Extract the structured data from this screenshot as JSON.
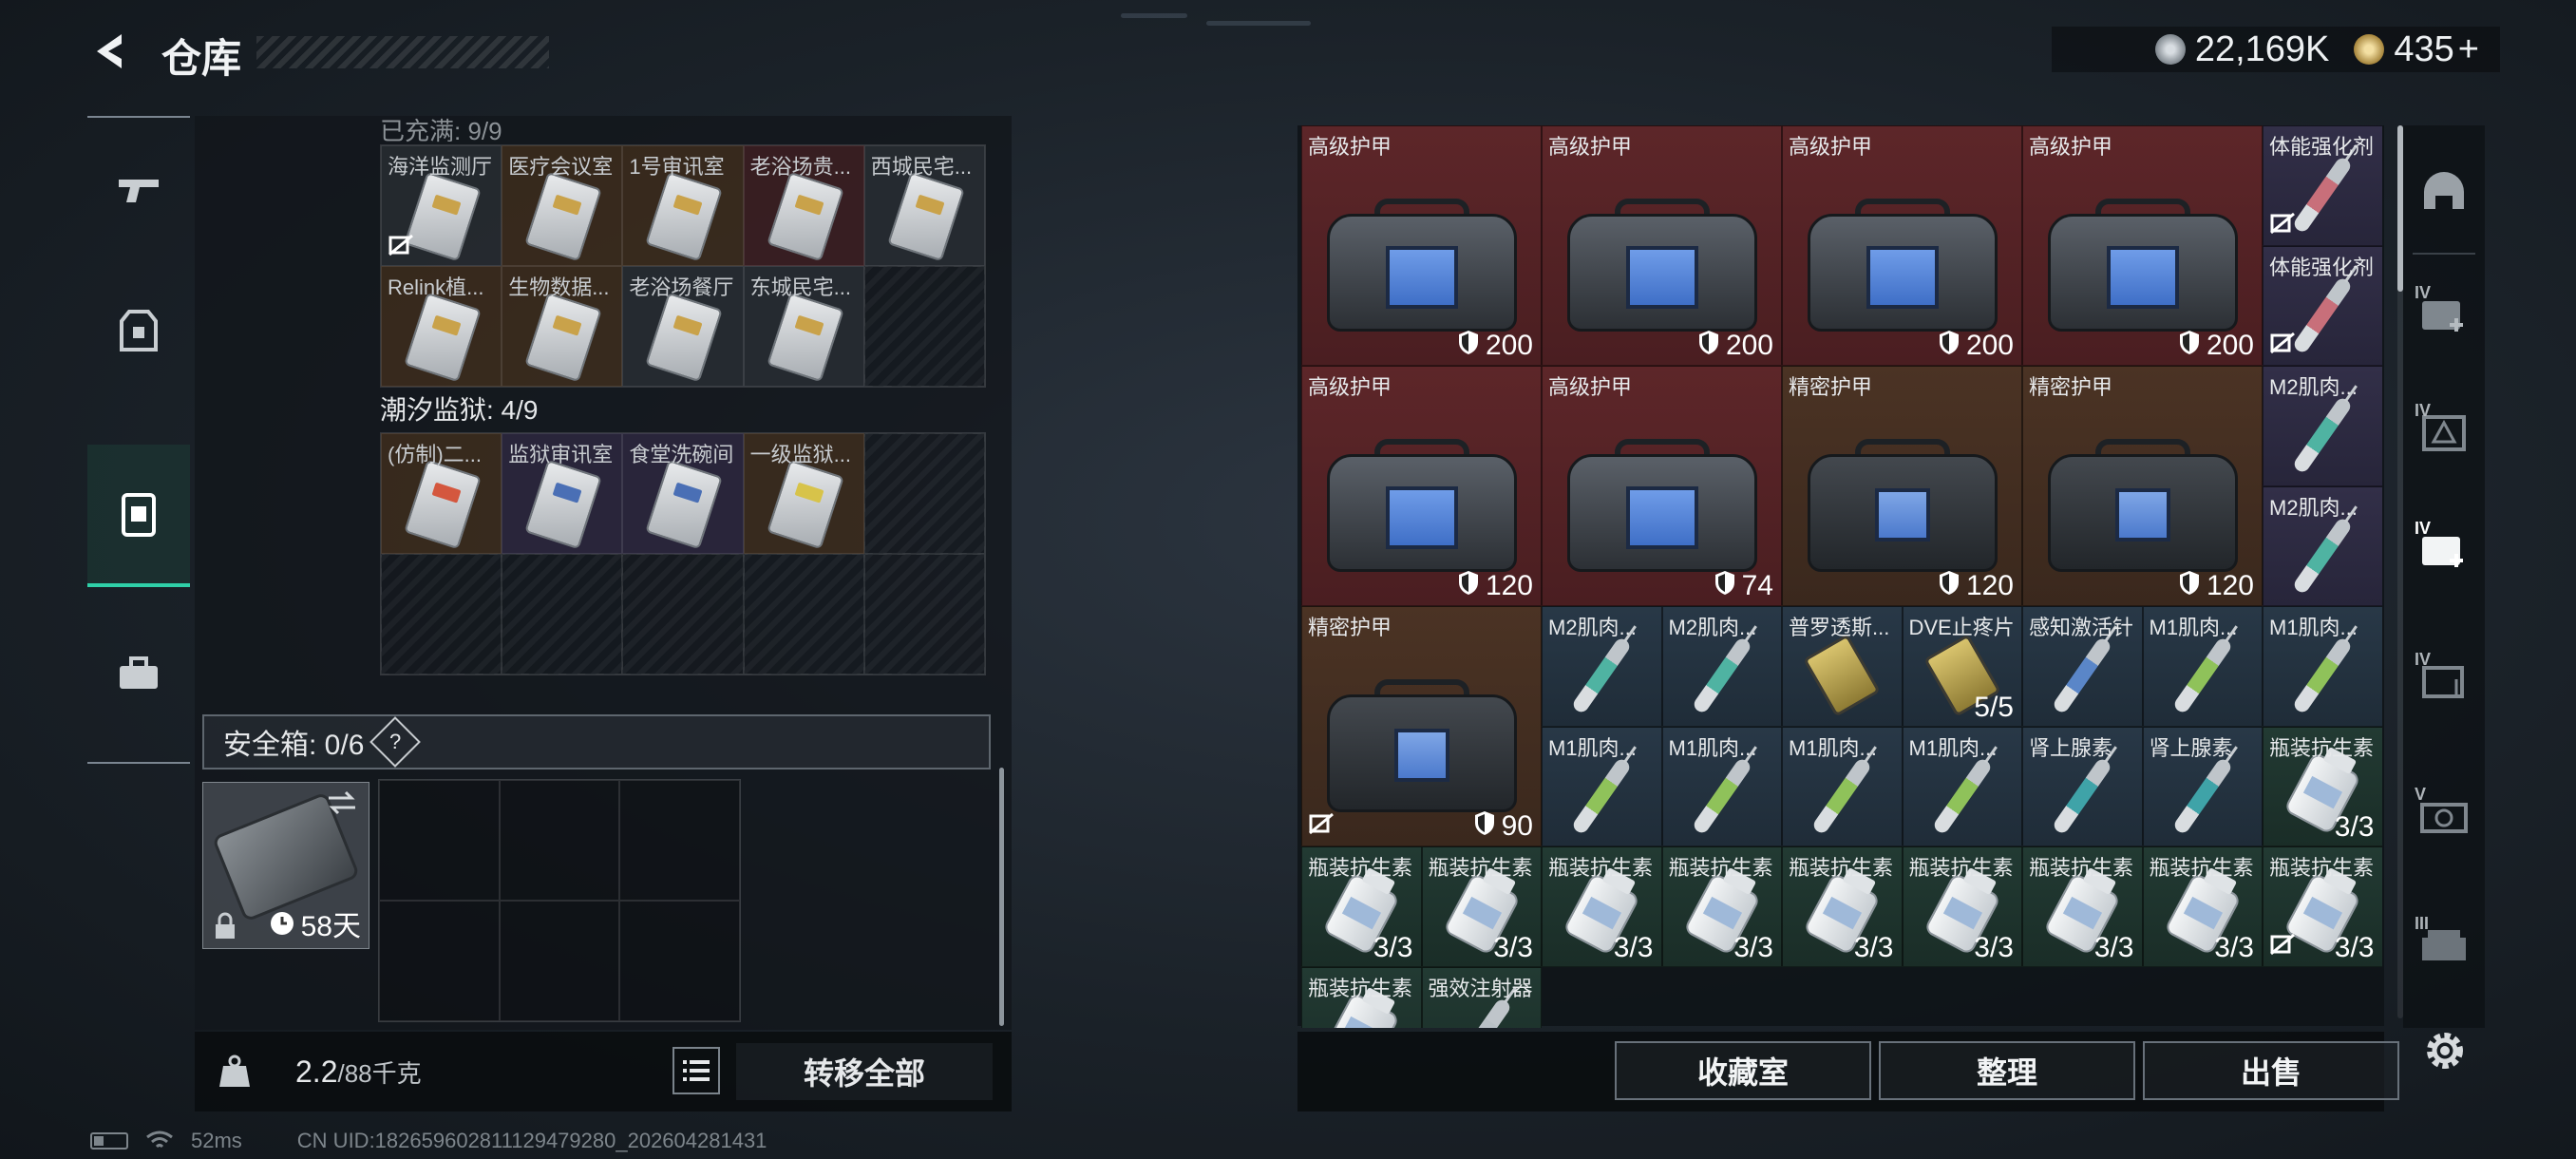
{
  "header": {
    "title": "仓库",
    "silver": "22,169K",
    "gold": "435",
    "gold_plus": "+"
  },
  "left": {
    "faded_title": "已充满: 9/9",
    "top_keys": [
      {
        "label": "海洋监测厅",
        "tint": "gray",
        "card": "",
        "noicon": true
      },
      {
        "label": "医疗会议室",
        "tint": "orange",
        "card": "",
        "noicon": false
      },
      {
        "label": "1号审讯室",
        "tint": "orange",
        "card": "",
        "noicon": false
      },
      {
        "label": "老浴场贵...",
        "tint": "red",
        "card": "",
        "noicon": false
      },
      {
        "label": "西城民宅...",
        "tint": "gray",
        "card": "",
        "noicon": false
      },
      {
        "label": "Relink植...",
        "tint": "orange",
        "card": "",
        "noicon": false
      },
      {
        "label": "生物数据...",
        "tint": "orange",
        "card": "",
        "noicon": false
      },
      {
        "label": "老浴场餐厅",
        "tint": "gray",
        "card": "",
        "noicon": false
      },
      {
        "label": "东城民宅...",
        "tint": "gray",
        "card": "",
        "noicon": false
      },
      {
        "label": "",
        "tint": "empty",
        "card": "",
        "noicon": false
      }
    ],
    "prison_title": "潮汐监狱: 4/9",
    "prison_keys": [
      {
        "label": "(仿制)二...",
        "tint": "orange",
        "card": "red"
      },
      {
        "label": "监狱审讯室",
        "tint": "purple",
        "card": "blue"
      },
      {
        "label": "食堂洗碗间",
        "tint": "purple",
        "card": "blue"
      },
      {
        "label": "一级监狱...",
        "tint": "orange",
        "card": "yellow"
      }
    ],
    "safebox_label": "安全箱: 0/6",
    "safebox_help": "?",
    "safe_days": "58天",
    "weight": "2.2",
    "weight_max": "/88千克",
    "transfer_all": "转移全部"
  },
  "status": {
    "ping": "52ms",
    "uid": "CN UID:1826596028111294792​80_202604281431"
  },
  "inventory": {
    "large": [
      {
        "name": "高级护甲",
        "val": "200",
        "quality": "red",
        "kind": "bag",
        "noicon": false
      },
      {
        "name": "高级护甲",
        "val": "200",
        "quality": "red",
        "kind": "bag",
        "noicon": false
      },
      {
        "name": "高级护甲",
        "val": "200",
        "quality": "red",
        "kind": "bag",
        "noicon": false
      },
      {
        "name": "高级护甲",
        "val": "200",
        "quality": "red",
        "kind": "bag",
        "noicon": false
      },
      {
        "name": "高级护甲",
        "val": "120",
        "quality": "red",
        "kind": "bag",
        "noicon": false
      },
      {
        "name": "高级护甲",
        "val": "74",
        "quality": "red",
        "kind": "bag",
        "noicon": false
      },
      {
        "name": "精密护甲",
        "val": "120",
        "quality": "orange",
        "kind": "dark",
        "noicon": false
      },
      {
        "name": "精密护甲",
        "val": "120",
        "quality": "orange",
        "kind": "dark",
        "noicon": false
      },
      {
        "name": "精密护甲",
        "val": "90",
        "quality": "orange",
        "kind": "dark",
        "noicon": true
      }
    ],
    "small": [
      {
        "name": "体能强化剂",
        "val": "",
        "quality": "purple",
        "kind": "syringe",
        "color": "#c86f7a",
        "noicon": true
      },
      {
        "name": "体能强化剂",
        "val": "",
        "quality": "purple",
        "kind": "syringe",
        "color": "#c86f7a",
        "noicon": true
      },
      {
        "name": "M2肌肉...",
        "val": "",
        "quality": "purple",
        "kind": "syringe",
        "color": "#4fb3a2",
        "noicon": false
      },
      {
        "name": "M2肌肉...",
        "val": "",
        "quality": "purple",
        "kind": "syringe",
        "color": "#4fb3a2",
        "noicon": false
      },
      {
        "name": "M2肌肉...",
        "val": "",
        "quality": "blue",
        "kind": "syringe",
        "color": "#4fb3a2",
        "noicon": false
      },
      {
        "name": "M2肌肉...",
        "val": "",
        "quality": "blue",
        "kind": "syringe",
        "color": "#4fb3a2",
        "noicon": false
      },
      {
        "name": "普罗透斯...",
        "val": "",
        "quality": "blue",
        "kind": "pills",
        "color": "",
        "noicon": false
      },
      {
        "name": "DVE止疼片",
        "val": "5/5",
        "quality": "blue",
        "kind": "pills",
        "color": "",
        "noicon": false
      },
      {
        "name": "感知激活针",
        "val": "",
        "quality": "blue",
        "kind": "syringe",
        "color": "#5a86c8",
        "noicon": false
      },
      {
        "name": "M1肌肉...",
        "val": "",
        "quality": "blue",
        "kind": "syringe",
        "color": "#8fc25a",
        "noicon": false
      },
      {
        "name": "M1肌肉...",
        "val": "",
        "quality": "blue",
        "kind": "syringe",
        "color": "#8fc25a",
        "noicon": false
      },
      {
        "name": "M1肌肉...",
        "val": "",
        "quality": "blue",
        "kind": "syringe",
        "color": "#8fc25a",
        "noicon": false
      },
      {
        "name": "M1肌肉...",
        "val": "",
        "quality": "blue",
        "kind": "syringe",
        "color": "#8fc25a",
        "noicon": false
      },
      {
        "name": "M1肌肉...",
        "val": "",
        "quality": "blue",
        "kind": "syringe",
        "color": "#8fc25a",
        "noicon": false
      },
      {
        "name": "M1肌肉...",
        "val": "",
        "quality": "blue",
        "kind": "syringe",
        "color": "#8fc25a",
        "noicon": false
      },
      {
        "name": "肾上腺素",
        "val": "",
        "quality": "blue",
        "kind": "syringe",
        "color": "#3fa3a8",
        "noicon": false
      },
      {
        "name": "肾上腺素",
        "val": "",
        "quality": "blue",
        "kind": "syringe",
        "color": "#3fa3a8",
        "noicon": false
      },
      {
        "name": "瓶装抗生素",
        "val": "3/3",
        "quality": "green",
        "kind": "bottle",
        "color": "",
        "noicon": false
      },
      {
        "name": "瓶装抗生素",
        "val": "3/3",
        "quality": "green",
        "kind": "bottle",
        "color": "",
        "noicon": false
      },
      {
        "name": "瓶装抗生素",
        "val": "3/3",
        "quality": "green",
        "kind": "bottle",
        "color": "",
        "noicon": false
      },
      {
        "name": "瓶装抗生素",
        "val": "3/3",
        "quality": "green",
        "kind": "bottle",
        "color": "",
        "noicon": false
      },
      {
        "name": "瓶装抗生素",
        "val": "3/3",
        "quality": "green",
        "kind": "bottle",
        "color": "",
        "noicon": false
      },
      {
        "name": "瓶装抗生素",
        "val": "3/3",
        "quality": "green",
        "kind": "bottle",
        "color": "",
        "noicon": false
      },
      {
        "name": "瓶装抗生素",
        "val": "3/3",
        "quality": "green",
        "kind": "bottle",
        "color": "",
        "noicon": false
      },
      {
        "name": "瓶装抗生素",
        "val": "3/3",
        "quality": "green",
        "kind": "bottle",
        "color": "",
        "noicon": false
      },
      {
        "name": "瓶装抗生素",
        "val": "3/3",
        "quality": "green",
        "kind": "bottle",
        "color": "",
        "noicon": false
      },
      {
        "name": "瓶装抗生素",
        "val": "3/3",
        "quality": "green",
        "kind": "bottle",
        "color": "",
        "noicon": true
      },
      {
        "name": "瓶装抗生素",
        "val": "",
        "quality": "green",
        "kind": "bottle",
        "color": "",
        "noicon": false
      },
      {
        "name": "强效注射器",
        "val": "",
        "quality": "green",
        "kind": "syringe",
        "color": "#b9c1c6",
        "noicon": false
      }
    ],
    "buttons": {
      "collection": "收藏室",
      "sort": "整理",
      "sell": "出售"
    }
  },
  "rail": {
    "tiers": [
      "IV",
      "IV",
      "IV",
      "IV",
      "V",
      "III"
    ]
  }
}
